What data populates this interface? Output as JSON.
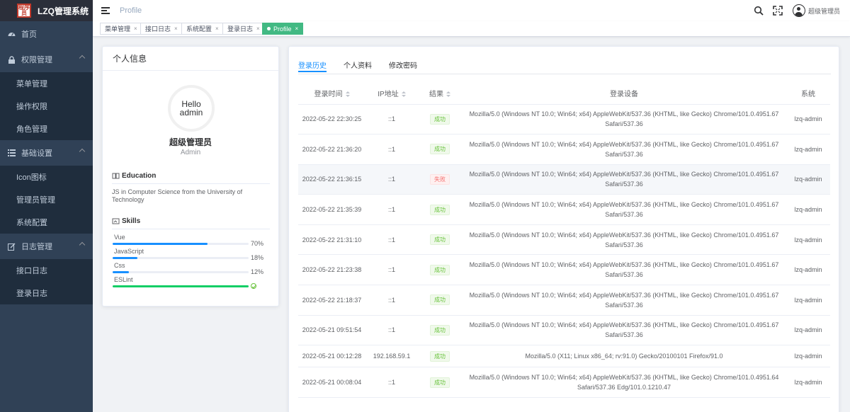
{
  "app": {
    "logo_text": "程序员",
    "title": "LZQ管理系统"
  },
  "sidebar": {
    "items": [
      {
        "type": "item",
        "label": "首页",
        "icon": "dashboard-icon"
      },
      {
        "type": "group",
        "label": "权限管理",
        "icon": "lock-icon",
        "children": [
          "菜单管理",
          "操作权限",
          "角色管理"
        ]
      },
      {
        "type": "group",
        "label": "基础设置",
        "icon": "list-icon",
        "children": [
          "Icon图标",
          "管理员管理",
          "系统配置"
        ]
      },
      {
        "type": "group",
        "label": "日志管理",
        "icon": "edit-icon",
        "children": [
          "接口日志",
          "登录日志"
        ]
      }
    ]
  },
  "header": {
    "breadcrumb": "Profile",
    "user_name": "超级管理员"
  },
  "tags": [
    {
      "label": "菜单管理",
      "active": false
    },
    {
      "label": "接口日志",
      "active": false
    },
    {
      "label": "系统配置",
      "active": false
    },
    {
      "label": "登录日志",
      "active": false
    },
    {
      "label": "Profile",
      "active": true
    }
  ],
  "profile": {
    "card_title": "个人信息",
    "avatar_line1": "Hello",
    "avatar_line2": "admin",
    "name": "超级管理员",
    "role": "Admin",
    "education_title": "Education",
    "education_text": "JS in Computer Science from the University of Technology",
    "skills_title": "Skills",
    "skills": [
      {
        "name": "Vue",
        "percent": 70,
        "pct_label": "70%",
        "color": "#1890ff"
      },
      {
        "name": "JavaScript",
        "percent": 18,
        "pct_label": "18%",
        "color": "#1890ff"
      },
      {
        "name": "Css",
        "percent": 12,
        "pct_label": "12%",
        "color": "#1890ff"
      },
      {
        "name": "ESLint",
        "percent": 100,
        "pct_label": "",
        "color": "#13ce66",
        "done": true
      }
    ]
  },
  "tabs": [
    {
      "label": "登录历史",
      "active": true
    },
    {
      "label": "个人资料",
      "active": false
    },
    {
      "label": "修改密码",
      "active": false
    }
  ],
  "login_table": {
    "columns": [
      "登录时间",
      "IP地址",
      "结果",
      "登录设备",
      "系统"
    ],
    "rows": [
      {
        "time": "2022-05-22 22:30:25",
        "ip": "::1",
        "result": "成功",
        "ok": true,
        "device": "Mozilla/5.0 (Windows NT 10.0; Win64; x64) AppleWebKit/537.36 (KHTML, like Gecko) Chrome/101.0.4951.67 Safari/537.36",
        "system": "lzq-admin"
      },
      {
        "time": "2022-05-22 21:36:20",
        "ip": "::1",
        "result": "成功",
        "ok": true,
        "device": "Mozilla/5.0 (Windows NT 10.0; Win64; x64) AppleWebKit/537.36 (KHTML, like Gecko) Chrome/101.0.4951.67 Safari/537.36",
        "system": "lzq-admin"
      },
      {
        "time": "2022-05-22 21:36:15",
        "ip": "::1",
        "result": "失败",
        "ok": false,
        "device": "Mozilla/5.0 (Windows NT 10.0; Win64; x64) AppleWebKit/537.36 (KHTML, like Gecko) Chrome/101.0.4951.67 Safari/537.36",
        "system": "lzq-admin"
      },
      {
        "time": "2022-05-22 21:35:39",
        "ip": "::1",
        "result": "成功",
        "ok": true,
        "device": "Mozilla/5.0 (Windows NT 10.0; Win64; x64) AppleWebKit/537.36 (KHTML, like Gecko) Chrome/101.0.4951.67 Safari/537.36",
        "system": "lzq-admin"
      },
      {
        "time": "2022-05-22 21:31:10",
        "ip": "::1",
        "result": "成功",
        "ok": true,
        "device": "Mozilla/5.0 (Windows NT 10.0; Win64; x64) AppleWebKit/537.36 (KHTML, like Gecko) Chrome/101.0.4951.67 Safari/537.36",
        "system": "lzq-admin"
      },
      {
        "time": "2022-05-22 21:23:38",
        "ip": "::1",
        "result": "成功",
        "ok": true,
        "device": "Mozilla/5.0 (Windows NT 10.0; Win64; x64) AppleWebKit/537.36 (KHTML, like Gecko) Chrome/101.0.4951.67 Safari/537.36",
        "system": "lzq-admin"
      },
      {
        "time": "2022-05-22 21:18:37",
        "ip": "::1",
        "result": "成功",
        "ok": true,
        "device": "Mozilla/5.0 (Windows NT 10.0; Win64; x64) AppleWebKit/537.36 (KHTML, like Gecko) Chrome/101.0.4951.67 Safari/537.36",
        "system": "lzq-admin"
      },
      {
        "time": "2022-05-21 09:51:54",
        "ip": "::1",
        "result": "成功",
        "ok": true,
        "device": "Mozilla/5.0 (Windows NT 10.0; Win64; x64) AppleWebKit/537.36 (KHTML, like Gecko) Chrome/101.0.4951.67 Safari/537.36",
        "system": "lzq-admin"
      },
      {
        "time": "2022-05-21 00:12:28",
        "ip": "192.168.59.1",
        "result": "成功",
        "ok": true,
        "device": "Mozilla/5.0 (X11; Linux x86_64; rv:91.0) Gecko/20100101 Firefox/91.0",
        "system": "lzq-admin"
      },
      {
        "time": "2022-05-21 00:08:04",
        "ip": "::1",
        "result": "成功",
        "ok": true,
        "device": "Mozilla/5.0 (Windows NT 10.0; Win64; x64) AppleWebKit/537.36 (KHTML, like Gecko) Chrome/101.0.4951.64 Safari/537.36 Edg/101.0.1210.47",
        "system": "lzq-admin"
      }
    ]
  }
}
